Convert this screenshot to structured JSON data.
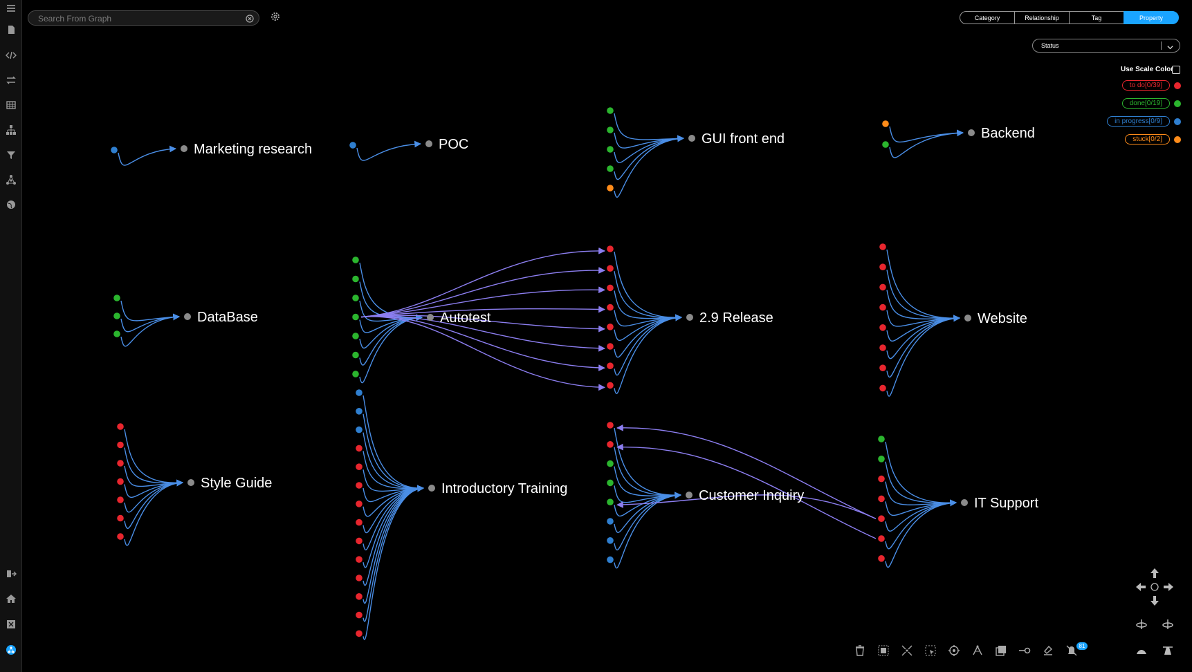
{
  "search": {
    "placeholder": "Search From Graph"
  },
  "tabs": [
    {
      "label": "Category",
      "active": false
    },
    {
      "label": "Relationship",
      "active": false
    },
    {
      "label": "Tag",
      "active": false
    },
    {
      "label": "Property",
      "active": true
    }
  ],
  "property_select": {
    "value": "Status"
  },
  "legend": {
    "use_scale_label": "Use Scale Color",
    "items": [
      {
        "label": "to do[0/39]",
        "color": "#e8262e"
      },
      {
        "label": "done[0/19]",
        "color": "#2bb52e"
      },
      {
        "label": "in progress[0/9]",
        "color": "#2f7fd0"
      },
      {
        "label": "stuck[0/2]",
        "color": "#ff8c1a"
      }
    ]
  },
  "colors": {
    "edge": "#4a8ee6",
    "cross_edge": "#8c7ef0",
    "hub": "#8a8a8a",
    "todo": "#e8262e",
    "done": "#2bb52e",
    "progress": "#2f7fd0",
    "stuck": "#ff8c1a",
    "accent": "#1aa4ff"
  },
  "graph": {
    "hubs": [
      {
        "id": "marketing",
        "label": "Marketing research",
        "leaves": [
          "progress"
        ]
      },
      {
        "id": "poc",
        "label": "POC",
        "leaves": [
          "progress"
        ]
      },
      {
        "id": "gui",
        "label": "GUI front end",
        "leaves": [
          "done",
          "done",
          "done",
          "done",
          "stuck"
        ]
      },
      {
        "id": "backend",
        "label": "Backend",
        "leaves": [
          "stuck",
          "done"
        ]
      },
      {
        "id": "database",
        "label": "DataBase",
        "leaves": [
          "done",
          "done",
          "done"
        ]
      },
      {
        "id": "autotest",
        "label": "Autotest",
        "leaves": [
          "done",
          "done",
          "done",
          "done",
          "done",
          "done",
          "done"
        ]
      },
      {
        "id": "release",
        "label": "2.9 Release",
        "leaves": [
          "todo",
          "todo",
          "todo",
          "todo",
          "todo",
          "todo",
          "todo",
          "todo"
        ]
      },
      {
        "id": "website",
        "label": "Website",
        "leaves": [
          "todo",
          "todo",
          "todo",
          "todo",
          "todo",
          "todo",
          "todo",
          "todo"
        ]
      },
      {
        "id": "styleguide",
        "label": "Style Guide",
        "leaves": [
          "todo",
          "todo",
          "todo",
          "todo",
          "todo",
          "todo",
          "todo"
        ]
      },
      {
        "id": "training",
        "label": "Introductory Training",
        "leaves": [
          "progress",
          "progress",
          "progress",
          "todo",
          "todo",
          "todo",
          "todo",
          "todo",
          "todo",
          "todo",
          "todo",
          "todo",
          "todo",
          "todo"
        ]
      },
      {
        "id": "inquiry",
        "label": "Customer Inquiry",
        "leaves": [
          "todo",
          "todo",
          "done",
          "done",
          "done",
          "progress",
          "progress",
          "progress"
        ]
      },
      {
        "id": "itsupport",
        "label": "IT Support",
        "leaves": [
          "done",
          "done",
          "todo",
          "todo",
          "todo",
          "todo",
          "todo"
        ]
      }
    ]
  },
  "toolbar": {
    "icons": [
      "trash-icon",
      "select-all-icon",
      "expand-icon",
      "marquee-select-icon",
      "focus-icon",
      "layout-icon",
      "duplicate-icon",
      "add-link-icon",
      "clear-icon",
      "notifications-icon"
    ],
    "badge": "81"
  },
  "sidebar": {
    "icons": [
      "menu-icon",
      "file-icon",
      "code-icon",
      "transfer-icon",
      "table-icon",
      "hierarchy-icon",
      "filter-icon",
      "network-icon",
      "globe-icon",
      "logout-icon",
      "home-icon",
      "dashboard-icon",
      "graph-app-icon"
    ]
  }
}
